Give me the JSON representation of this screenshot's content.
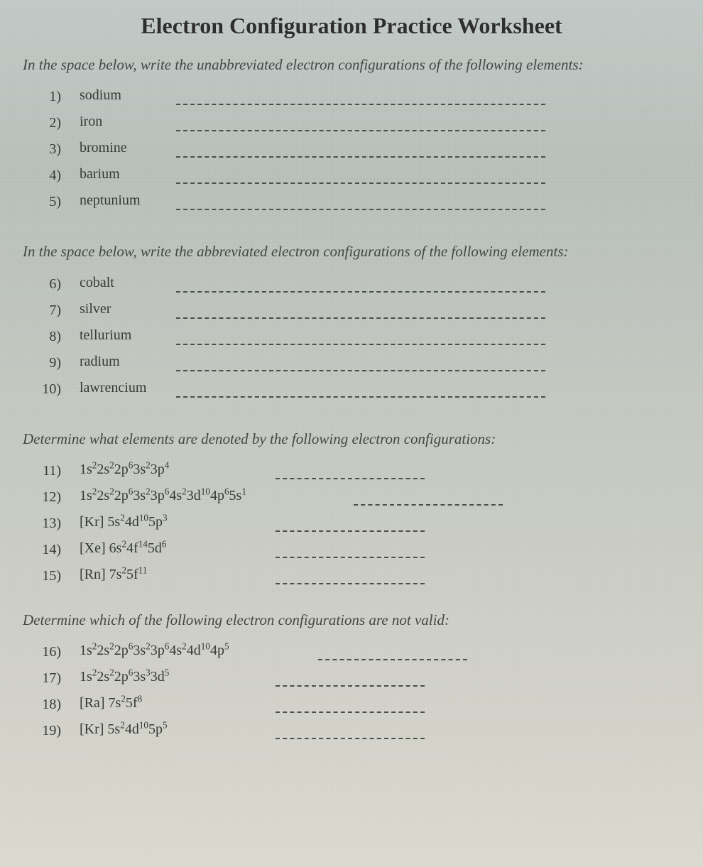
{
  "title": "Electron Configuration Practice Worksheet",
  "sections": [
    {
      "instructions": "In the space below, write the unabbreviated electron configurations of the following elements:",
      "items": [
        {
          "num": "1)",
          "label": "sodium"
        },
        {
          "num": "2)",
          "label": "iron"
        },
        {
          "num": "3)",
          "label": "bromine"
        },
        {
          "num": "4)",
          "label": "barium"
        },
        {
          "num": "5)",
          "label": "neptunium"
        }
      ]
    },
    {
      "instructions": "In the space below, write the abbreviated electron configurations of the following elements:",
      "items": [
        {
          "num": "6)",
          "label": "cobalt"
        },
        {
          "num": "7)",
          "label": "silver"
        },
        {
          "num": "8)",
          "label": "tellurium"
        },
        {
          "num": "9)",
          "label": "radium"
        },
        {
          "num": "10)",
          "label": "lawrencium"
        }
      ]
    },
    {
      "instructions": "Determine what elements are denoted by the following electron configurations:",
      "items": [
        {
          "num": "11)",
          "label_html": "1s<sup>2</sup>2s<sup>2</sup>2p<sup>6</sup>3s<sup>2</sup>3p<sup>4</sup>"
        },
        {
          "num": "12)",
          "label_html": "1s<sup>2</sup>2s<sup>2</sup>2p<sup>6</sup>3s<sup>2</sup>3p<sup>6</sup>4s<sup>2</sup>3d<sup>10</sup>4p<sup>6</sup>5s<sup>1</sup>"
        },
        {
          "num": "13)",
          "label_html": "[Kr] 5s<sup>2</sup>4d<sup>10</sup>5p<sup>3</sup>"
        },
        {
          "num": "14)",
          "label_html": "[Xe] 6s<sup>2</sup>4f<sup>14</sup>5d<sup>6</sup>"
        },
        {
          "num": "15)",
          "label_html": "[Rn] 7s<sup>2</sup>5f<sup>11</sup>"
        }
      ]
    },
    {
      "instructions": "Determine which of the following electron configurations are not valid:",
      "items": [
        {
          "num": "16)",
          "label_html": "1s<sup>2</sup>2s<sup>2</sup>2p<sup>6</sup>3s<sup>2</sup>3p<sup>6</sup>4s<sup>2</sup>4d<sup>10</sup>4p<sup>5</sup>"
        },
        {
          "num": "17)",
          "label_html": "1s<sup>2</sup>2s<sup>2</sup>2p<sup>6</sup>3s<sup>3</sup>3d<sup>5</sup>"
        },
        {
          "num": "18)",
          "label_html": "[Ra] 7s<sup>2</sup>5f<sup>8</sup>"
        },
        {
          "num": "19)",
          "label_html": "[Kr] 5s<sup>2</sup>4d<sup>10</sup>5p<sup>5</sup>"
        }
      ]
    }
  ]
}
